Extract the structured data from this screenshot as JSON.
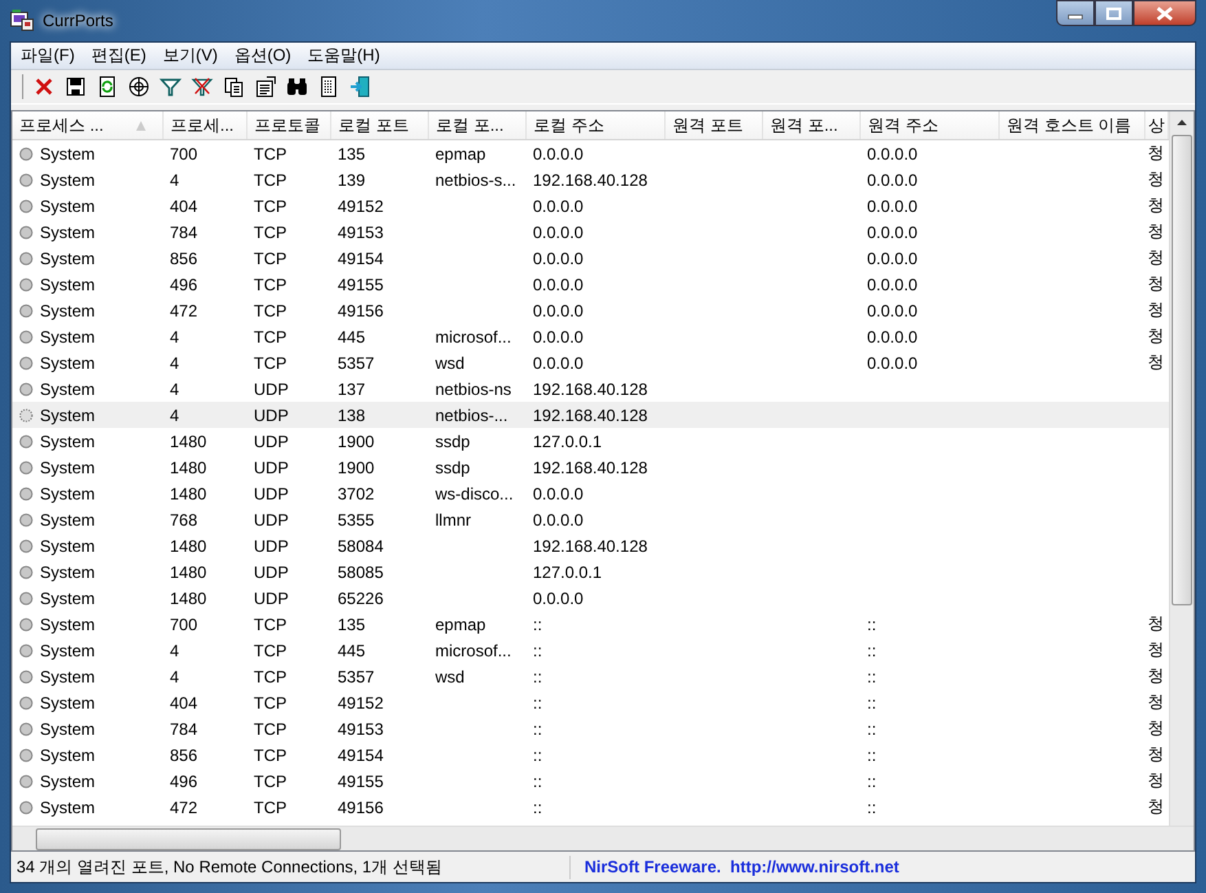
{
  "window": {
    "title": "CurrPorts"
  },
  "menu": [
    "파일(F)",
    "편집(E)",
    "보기(V)",
    "옵션(O)",
    "도움말(H)"
  ],
  "table": {
    "columns": [
      {
        "label": "프로세스 ...",
        "sorted": true
      },
      {
        "label": "프로세...",
        "sorted": false
      },
      {
        "label": "프로토콜",
        "sorted": false
      },
      {
        "label": "로컬 포트",
        "sorted": false
      },
      {
        "label": "로컬 포...",
        "sorted": false
      },
      {
        "label": "로컬 주소",
        "sorted": false
      },
      {
        "label": "원격 포트",
        "sorted": false
      },
      {
        "label": "원격 포...",
        "sorted": false
      },
      {
        "label": "원격 주소",
        "sorted": false
      },
      {
        "label": "원격 호스트 이름",
        "sorted": false
      },
      {
        "label": "상",
        "sorted": false
      }
    ],
    "rows": [
      {
        "selected": false,
        "cells": [
          "System",
          "700",
          "TCP",
          "135",
          "epmap",
          "0.0.0.0",
          null,
          null,
          "0.0.0.0",
          null,
          "청"
        ]
      },
      {
        "selected": false,
        "cells": [
          "System",
          "4",
          "TCP",
          "139",
          "netbios-s...",
          "192.168.40.128",
          null,
          null,
          "0.0.0.0",
          null,
          "청"
        ]
      },
      {
        "selected": false,
        "cells": [
          "System",
          "404",
          "TCP",
          "49152",
          null,
          "0.0.0.0",
          null,
          null,
          "0.0.0.0",
          null,
          "청"
        ]
      },
      {
        "selected": false,
        "cells": [
          "System",
          "784",
          "TCP",
          "49153",
          null,
          "0.0.0.0",
          null,
          null,
          "0.0.0.0",
          null,
          "청"
        ]
      },
      {
        "selected": false,
        "cells": [
          "System",
          "856",
          "TCP",
          "49154",
          null,
          "0.0.0.0",
          null,
          null,
          "0.0.0.0",
          null,
          "청"
        ]
      },
      {
        "selected": false,
        "cells": [
          "System",
          "496",
          "TCP",
          "49155",
          null,
          "0.0.0.0",
          null,
          null,
          "0.0.0.0",
          null,
          "청"
        ]
      },
      {
        "selected": false,
        "cells": [
          "System",
          "472",
          "TCP",
          "49156",
          null,
          "0.0.0.0",
          null,
          null,
          "0.0.0.0",
          null,
          "청"
        ]
      },
      {
        "selected": false,
        "cells": [
          "System",
          "4",
          "TCP",
          "445",
          "microsof...",
          "0.0.0.0",
          null,
          null,
          "0.0.0.0",
          null,
          "청"
        ]
      },
      {
        "selected": false,
        "cells": [
          "System",
          "4",
          "TCP",
          "5357",
          "wsd",
          "0.0.0.0",
          null,
          null,
          "0.0.0.0",
          null,
          "청"
        ]
      },
      {
        "selected": false,
        "cells": [
          "System",
          "4",
          "UDP",
          "137",
          "netbios-ns",
          "192.168.40.128",
          null,
          null,
          null,
          null,
          null
        ]
      },
      {
        "selected": true,
        "cells": [
          "System",
          "4",
          "UDP",
          "138",
          "netbios-...",
          "192.168.40.128",
          null,
          null,
          null,
          null,
          null
        ]
      },
      {
        "selected": false,
        "cells": [
          "System",
          "1480",
          "UDP",
          "1900",
          "ssdp",
          "127.0.0.1",
          null,
          null,
          null,
          null,
          null
        ]
      },
      {
        "selected": false,
        "cells": [
          "System",
          "1480",
          "UDP",
          "1900",
          "ssdp",
          "192.168.40.128",
          null,
          null,
          null,
          null,
          null
        ]
      },
      {
        "selected": false,
        "cells": [
          "System",
          "1480",
          "UDP",
          "3702",
          "ws-disco...",
          "0.0.0.0",
          null,
          null,
          null,
          null,
          null
        ]
      },
      {
        "selected": false,
        "cells": [
          "System",
          "768",
          "UDP",
          "5355",
          "llmnr",
          "0.0.0.0",
          null,
          null,
          null,
          null,
          null
        ]
      },
      {
        "selected": false,
        "cells": [
          "System",
          "1480",
          "UDP",
          "58084",
          null,
          "192.168.40.128",
          null,
          null,
          null,
          null,
          null
        ]
      },
      {
        "selected": false,
        "cells": [
          "System",
          "1480",
          "UDP",
          "58085",
          null,
          "127.0.0.1",
          null,
          null,
          null,
          null,
          null
        ]
      },
      {
        "selected": false,
        "cells": [
          "System",
          "1480",
          "UDP",
          "65226",
          null,
          "0.0.0.0",
          null,
          null,
          null,
          null,
          null
        ]
      },
      {
        "selected": false,
        "cells": [
          "System",
          "700",
          "TCP",
          "135",
          "epmap",
          "::",
          null,
          null,
          "::",
          null,
          "청"
        ]
      },
      {
        "selected": false,
        "cells": [
          "System",
          "4",
          "TCP",
          "445",
          "microsof...",
          "::",
          null,
          null,
          "::",
          null,
          "청"
        ]
      },
      {
        "selected": false,
        "cells": [
          "System",
          "4",
          "TCP",
          "5357",
          "wsd",
          "::",
          null,
          null,
          "::",
          null,
          "청"
        ]
      },
      {
        "selected": false,
        "cells": [
          "System",
          "404",
          "TCP",
          "49152",
          null,
          "::",
          null,
          null,
          "::",
          null,
          "청"
        ]
      },
      {
        "selected": false,
        "cells": [
          "System",
          "784",
          "TCP",
          "49153",
          null,
          "::",
          null,
          null,
          "::",
          null,
          "청"
        ]
      },
      {
        "selected": false,
        "cells": [
          "System",
          "856",
          "TCP",
          "49154",
          null,
          "::",
          null,
          null,
          "::",
          null,
          "청"
        ]
      },
      {
        "selected": false,
        "cells": [
          "System",
          "496",
          "TCP",
          "49155",
          null,
          "::",
          null,
          null,
          "::",
          null,
          "청"
        ]
      },
      {
        "selected": false,
        "cells": [
          "System",
          "472",
          "TCP",
          "49156",
          null,
          "::",
          null,
          null,
          "::",
          null,
          "청"
        ]
      }
    ]
  },
  "status_bar": {
    "summary": "34 개의 열려진 포트, No Remote Connections, 1개 선택됨",
    "link": "NirSoft Freeware.  http://www.nirsoft.net"
  }
}
